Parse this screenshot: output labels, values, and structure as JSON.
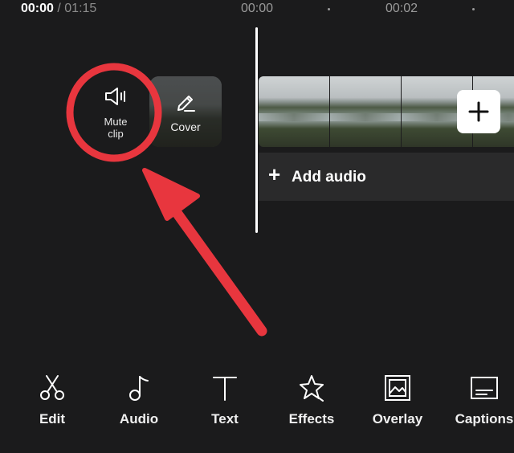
{
  "timeline": {
    "current_time": "00:00",
    "separator": "/",
    "total_time": "01:15",
    "ruler_labels": [
      "00:00",
      "00:02"
    ]
  },
  "clip_actions": {
    "mute_label_line1": "Mute",
    "mute_label_line2": "clip",
    "cover_label": "Cover"
  },
  "audio_track": {
    "add_audio_label": "Add audio"
  },
  "toolbar": {
    "items": [
      {
        "label": "Edit",
        "icon": "scissors-icon"
      },
      {
        "label": "Audio",
        "icon": "music-note-icon"
      },
      {
        "label": "Text",
        "icon": "text-icon"
      },
      {
        "label": "Effects",
        "icon": "star-effects-icon"
      },
      {
        "label": "Overlay",
        "icon": "overlay-icon"
      },
      {
        "label": "Captions",
        "icon": "captions-icon"
      }
    ]
  },
  "colors": {
    "background": "#1b1b1c",
    "annotation": "#e8363e",
    "track": "#2a2a2b"
  }
}
